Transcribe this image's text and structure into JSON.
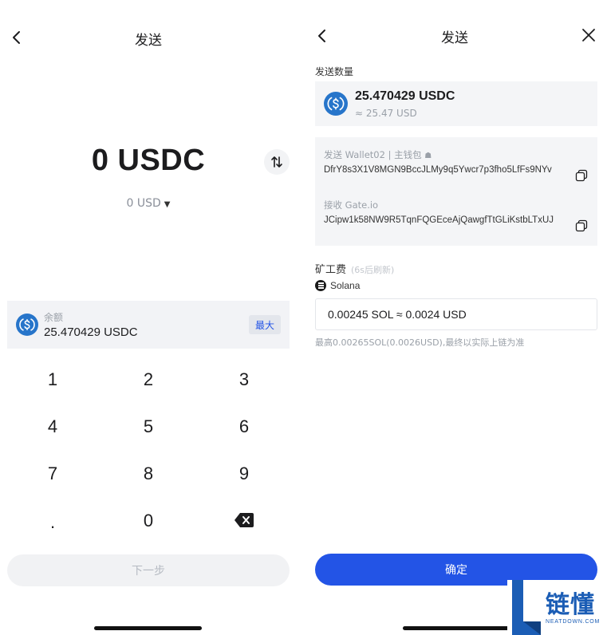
{
  "left": {
    "title": "发送",
    "amount": "0 USDC",
    "fiat": "0 USD",
    "balance": {
      "label": "余额",
      "value": "25.470429 USDC",
      "max_label": "最大"
    },
    "keypad": [
      "1",
      "2",
      "3",
      "4",
      "5",
      "6",
      "7",
      "8",
      "9",
      ".",
      "0"
    ],
    "next_label": "下一步",
    "icons": {
      "back": "chevron-left-icon",
      "swap": "swap-vertical-icon",
      "backspace": "backspace-icon",
      "coin": "usdc-coin-icon"
    }
  },
  "right": {
    "title": "发送",
    "amount_label": "发送数量",
    "amount_main": "25.470429 USDC",
    "amount_sub": "≈ 25.47 USD",
    "from_label": "发送 Wallet02 | 主钱包",
    "from_address": "DfrY8s3X1V8MGN9BccJLMy9q5Ywcr7p3fho5LfFs9NYv",
    "to_label": "接收 Gate.io",
    "to_address": "JCipw1k58NW9R5TqnFQGEceAjQawgfTtGLiKstbLTxUJ",
    "fee_title": "矿工费",
    "fee_refresh": "(6s后刷新)",
    "network": "Solana",
    "fee_value": "0.00245 SOL ≈ 0.0024 USD",
    "fee_note": "最高0.00265SOL(0.0026USD),最终以实际上链为准",
    "confirm_label": "确定",
    "icons": {
      "back": "chevron-left-icon",
      "close": "close-icon",
      "copy": "copy-icon",
      "network": "solana-icon"
    }
  },
  "watermark": {
    "cn": "链懂",
    "en": "NEATDOWN.COM"
  },
  "colors": {
    "accent": "#2354e6",
    "usdc": "#2775ca",
    "panel": "#f4f5f7",
    "muted": "#9aa0a8"
  }
}
